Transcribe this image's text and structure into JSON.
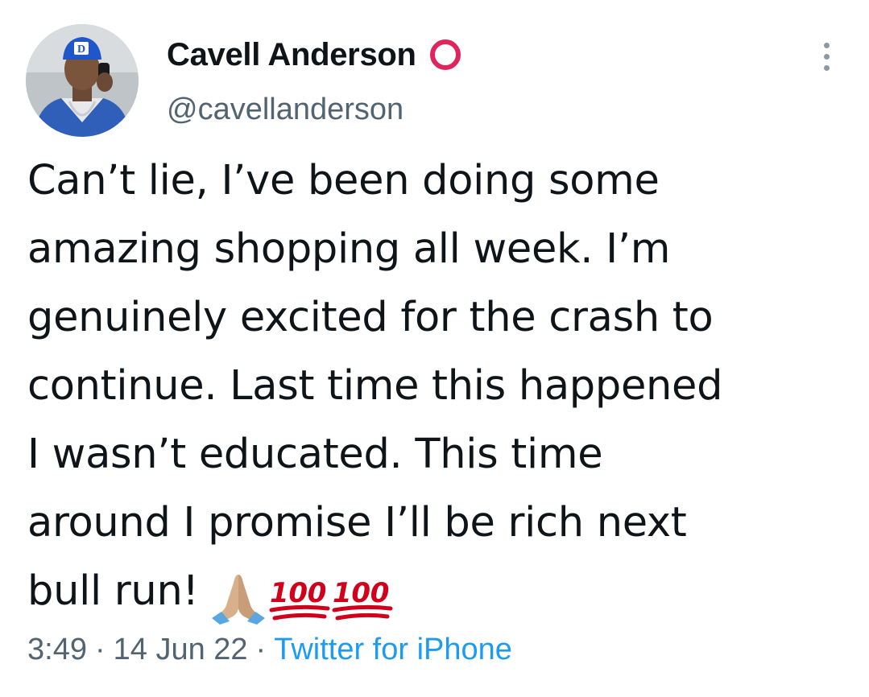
{
  "author": {
    "display_name": "Cavell Anderson",
    "handle": "@cavellanderson",
    "badge_icon": "red-ring-icon",
    "avatar_icon": "profile-photo-avatar"
  },
  "tweet": {
    "lines": [
      "Can’t lie, I’ve been doing some",
      "amazing shopping all week. I’m",
      "genuinely excited for the crash to",
      "continue. Last time this happened",
      "I wasn’t educated. This time",
      "around I promise I’ll be rich next",
      "bull run!"
    ],
    "emojis": [
      "folded-hands-icon",
      "hundred-points-icon",
      "hundred-points-icon"
    ]
  },
  "meta": {
    "time": "3:49",
    "date": "14 Jun 22",
    "separator": "·",
    "source": "Twitter for iPhone"
  },
  "colors": {
    "text": "#0f1419",
    "secondary": "#536471",
    "link": "#1d9bf0",
    "badge": "#e0245e"
  },
  "more_icon": "more-options-icon"
}
